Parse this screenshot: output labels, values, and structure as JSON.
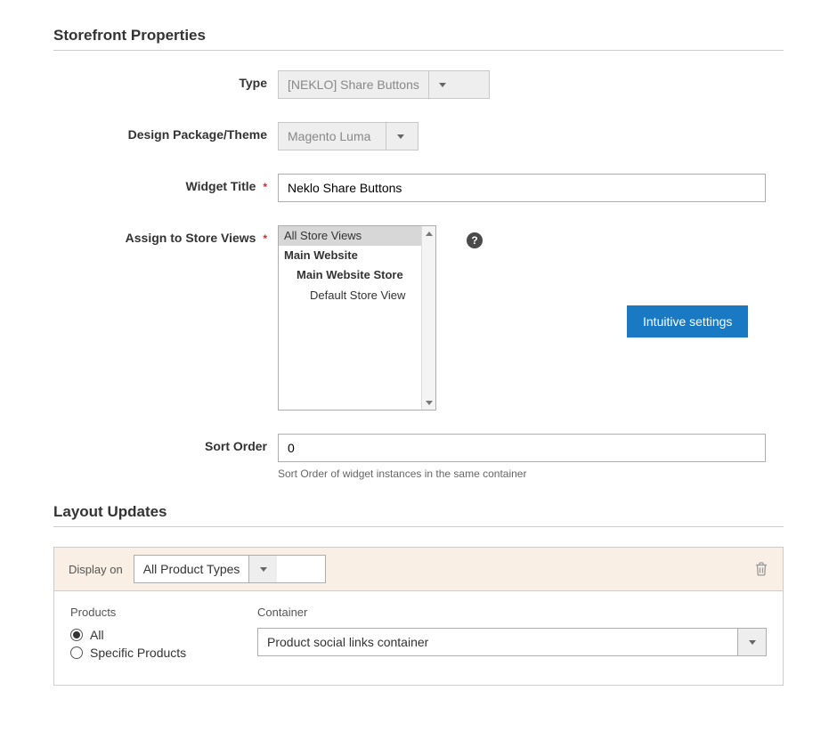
{
  "storefront": {
    "heading": "Storefront Properties",
    "type_label": "Type",
    "type_value": "[NEKLO] Share Buttons",
    "theme_label": "Design Package/Theme",
    "theme_value": "Magento Luma",
    "widget_title_label": "Widget Title",
    "widget_title_value": "Neklo Share Buttons",
    "store_views_label": "Assign to Store Views",
    "store_views_options": {
      "o0": "All Store Views",
      "o1": "Main Website",
      "o2": "Main Website Store",
      "o3": "Default Store View"
    },
    "help_glyph": "?",
    "callout_label": "Intuitive settings",
    "sort_order_label": "Sort Order",
    "sort_order_value": "0",
    "sort_order_note": "Sort Order of widget instances in the same container",
    "required_glyph": "*"
  },
  "layout": {
    "heading": "Layout Updates",
    "display_on_label": "Display on",
    "display_on_value": "All Product Types",
    "products_heading": "Products",
    "radio_all": "All",
    "radio_specific": "Specific Products",
    "container_heading": "Container",
    "container_value": "Product social links container"
  }
}
